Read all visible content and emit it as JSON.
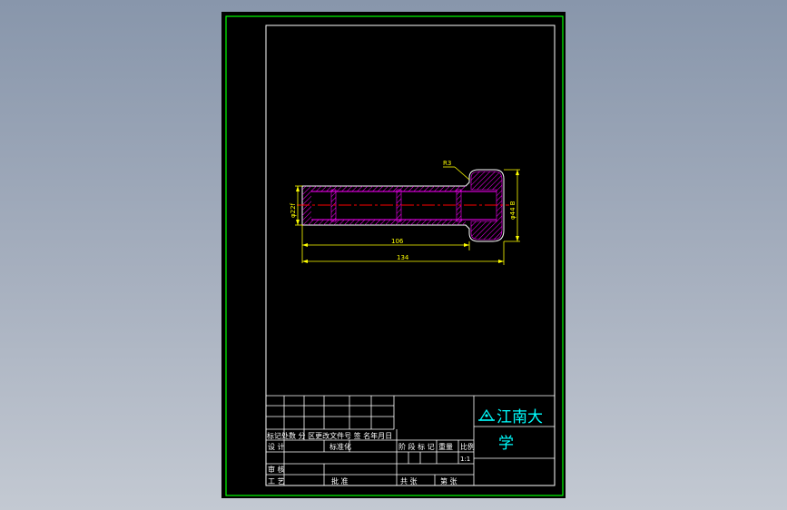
{
  "drawing": {
    "dimensions": {
      "shank_diameter": "φ22f",
      "head_diameter": "φ44 B",
      "fillet_radius": "R3",
      "shank_length": "106",
      "overall_length": "134"
    }
  },
  "title_block": {
    "school": {
      "line1": "江南大",
      "line2": "学"
    },
    "left_cells": {
      "revision_header": "标记处数 分 区更改文件号 签 名年月日",
      "design": "设 计",
      "design_value": "标准化",
      "review": "审 核",
      "process": "工 艺",
      "approve": "批 准"
    },
    "right_cells": {
      "stage_mark": "阶 段 标 记",
      "weight": "重量",
      "scale": "比例",
      "scale_value": "1:1",
      "total": "共 张",
      "sheet": "第 张"
    }
  },
  "colors": {
    "background": "#000000",
    "frame_outer": "#00ff00",
    "frame_inner": "#ffffff",
    "part_outline": "#ffffff",
    "hatch": "#ff00ff",
    "centerline": "#ff0000",
    "dimension": "#ffff00",
    "school_text": "#00ffff"
  }
}
